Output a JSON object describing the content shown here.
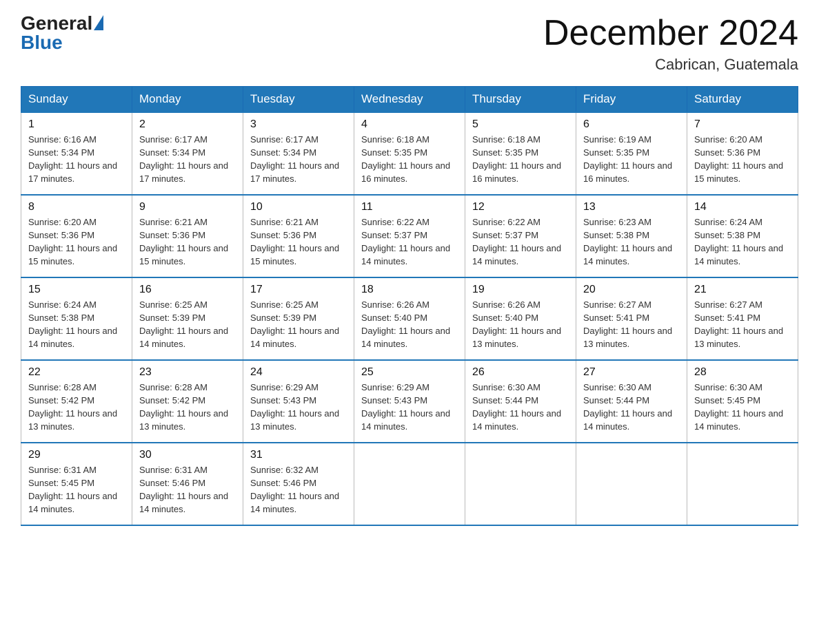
{
  "header": {
    "logo_general": "General",
    "logo_blue": "Blue",
    "month_title": "December 2024",
    "location": "Cabrican, Guatemala"
  },
  "days_of_week": [
    "Sunday",
    "Monday",
    "Tuesday",
    "Wednesday",
    "Thursday",
    "Friday",
    "Saturday"
  ],
  "weeks": [
    [
      {
        "day": "1",
        "sunrise": "6:16 AM",
        "sunset": "5:34 PM",
        "daylight": "11 hours and 17 minutes."
      },
      {
        "day": "2",
        "sunrise": "6:17 AM",
        "sunset": "5:34 PM",
        "daylight": "11 hours and 17 minutes."
      },
      {
        "day": "3",
        "sunrise": "6:17 AM",
        "sunset": "5:34 PM",
        "daylight": "11 hours and 17 minutes."
      },
      {
        "day": "4",
        "sunrise": "6:18 AM",
        "sunset": "5:35 PM",
        "daylight": "11 hours and 16 minutes."
      },
      {
        "day": "5",
        "sunrise": "6:18 AM",
        "sunset": "5:35 PM",
        "daylight": "11 hours and 16 minutes."
      },
      {
        "day": "6",
        "sunrise": "6:19 AM",
        "sunset": "5:35 PM",
        "daylight": "11 hours and 16 minutes."
      },
      {
        "day": "7",
        "sunrise": "6:20 AM",
        "sunset": "5:36 PM",
        "daylight": "11 hours and 15 minutes."
      }
    ],
    [
      {
        "day": "8",
        "sunrise": "6:20 AM",
        "sunset": "5:36 PM",
        "daylight": "11 hours and 15 minutes."
      },
      {
        "day": "9",
        "sunrise": "6:21 AM",
        "sunset": "5:36 PM",
        "daylight": "11 hours and 15 minutes."
      },
      {
        "day": "10",
        "sunrise": "6:21 AM",
        "sunset": "5:36 PM",
        "daylight": "11 hours and 15 minutes."
      },
      {
        "day": "11",
        "sunrise": "6:22 AM",
        "sunset": "5:37 PM",
        "daylight": "11 hours and 14 minutes."
      },
      {
        "day": "12",
        "sunrise": "6:22 AM",
        "sunset": "5:37 PM",
        "daylight": "11 hours and 14 minutes."
      },
      {
        "day": "13",
        "sunrise": "6:23 AM",
        "sunset": "5:38 PM",
        "daylight": "11 hours and 14 minutes."
      },
      {
        "day": "14",
        "sunrise": "6:24 AM",
        "sunset": "5:38 PM",
        "daylight": "11 hours and 14 minutes."
      }
    ],
    [
      {
        "day": "15",
        "sunrise": "6:24 AM",
        "sunset": "5:38 PM",
        "daylight": "11 hours and 14 minutes."
      },
      {
        "day": "16",
        "sunrise": "6:25 AM",
        "sunset": "5:39 PM",
        "daylight": "11 hours and 14 minutes."
      },
      {
        "day": "17",
        "sunrise": "6:25 AM",
        "sunset": "5:39 PM",
        "daylight": "11 hours and 14 minutes."
      },
      {
        "day": "18",
        "sunrise": "6:26 AM",
        "sunset": "5:40 PM",
        "daylight": "11 hours and 14 minutes."
      },
      {
        "day": "19",
        "sunrise": "6:26 AM",
        "sunset": "5:40 PM",
        "daylight": "11 hours and 13 minutes."
      },
      {
        "day": "20",
        "sunrise": "6:27 AM",
        "sunset": "5:41 PM",
        "daylight": "11 hours and 13 minutes."
      },
      {
        "day": "21",
        "sunrise": "6:27 AM",
        "sunset": "5:41 PM",
        "daylight": "11 hours and 13 minutes."
      }
    ],
    [
      {
        "day": "22",
        "sunrise": "6:28 AM",
        "sunset": "5:42 PM",
        "daylight": "11 hours and 13 minutes."
      },
      {
        "day": "23",
        "sunrise": "6:28 AM",
        "sunset": "5:42 PM",
        "daylight": "11 hours and 13 minutes."
      },
      {
        "day": "24",
        "sunrise": "6:29 AM",
        "sunset": "5:43 PM",
        "daylight": "11 hours and 13 minutes."
      },
      {
        "day": "25",
        "sunrise": "6:29 AM",
        "sunset": "5:43 PM",
        "daylight": "11 hours and 14 minutes."
      },
      {
        "day": "26",
        "sunrise": "6:30 AM",
        "sunset": "5:44 PM",
        "daylight": "11 hours and 14 minutes."
      },
      {
        "day": "27",
        "sunrise": "6:30 AM",
        "sunset": "5:44 PM",
        "daylight": "11 hours and 14 minutes."
      },
      {
        "day": "28",
        "sunrise": "6:30 AM",
        "sunset": "5:45 PM",
        "daylight": "11 hours and 14 minutes."
      }
    ],
    [
      {
        "day": "29",
        "sunrise": "6:31 AM",
        "sunset": "5:45 PM",
        "daylight": "11 hours and 14 minutes."
      },
      {
        "day": "30",
        "sunrise": "6:31 AM",
        "sunset": "5:46 PM",
        "daylight": "11 hours and 14 minutes."
      },
      {
        "day": "31",
        "sunrise": "6:32 AM",
        "sunset": "5:46 PM",
        "daylight": "11 hours and 14 minutes."
      },
      null,
      null,
      null,
      null
    ]
  ]
}
